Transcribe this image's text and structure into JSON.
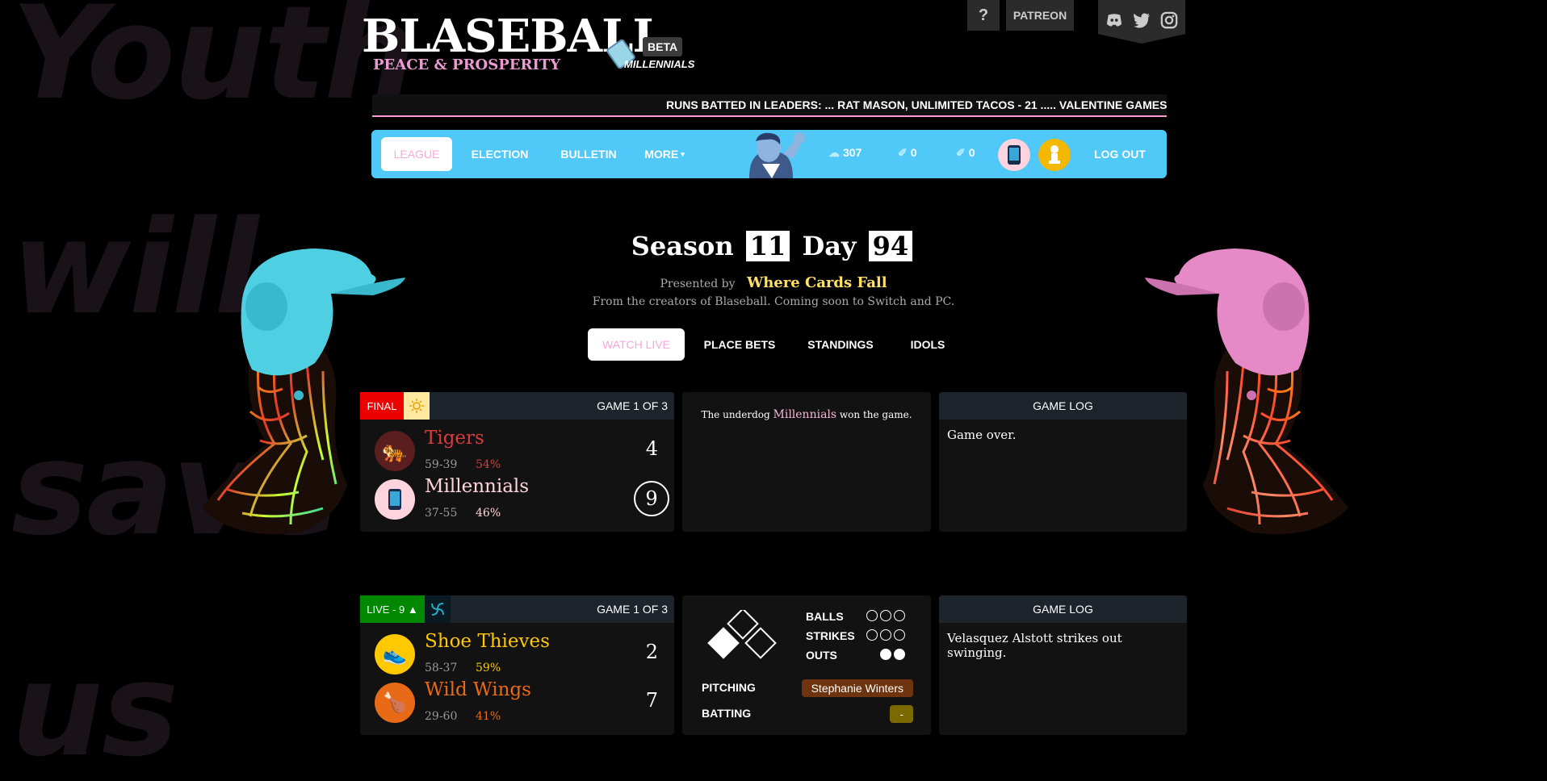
{
  "background_text": [
    "Youth",
    "will",
    "save",
    "us"
  ],
  "util": {
    "help_label": "?",
    "patreon_label": "PATREON"
  },
  "socials": [
    "discord-icon",
    "twitter-icon",
    "instagram-icon"
  ],
  "logo": {
    "title": "BLASEBALL",
    "subtitle": "PEACE & PROSPERITY",
    "badge": "BETA",
    "team_logo": "MILLENNIALS"
  },
  "ticker": {
    "text": "RUNS BATTED IN LEADERS: ... RAT MASON, UNLIMITED TACOS - 21 ..... VALENTINE GAMES, U"
  },
  "nav": {
    "league": "LEAGUE",
    "election": "ELECTION",
    "bulletin": "BULLETIN",
    "more": "MORE",
    "coins_glyph": "☁",
    "coins": "307",
    "votes_glyph": "✐",
    "votes": "0",
    "snacks_glyph": "✐",
    "snacks": "0",
    "logout": "LOG OUT"
  },
  "season": {
    "season_label": "Season",
    "season_num": "11",
    "day_label": "Day",
    "day_num": "94"
  },
  "sponsor": {
    "presented_by": "Presented by",
    "name": "Where Cards Fall",
    "tagline": "From the creators of Blaseball. Coming soon to Switch and PC."
  },
  "tabs": {
    "watch_live": "WATCH LIVE",
    "place_bets": "PLACE BETS",
    "standings": "STANDINGS",
    "idols": "IDOLS"
  },
  "game1": {
    "status": "FINAL",
    "game_number": "GAME 1 OF 3",
    "away": {
      "name": "Tigers",
      "record": "59-39",
      "odds": "54%",
      "score": "4",
      "color": "#d93c3c",
      "emoji": "🐅"
    },
    "home": {
      "name": "Millennials",
      "record": "37-55",
      "odds": "46%",
      "score": "9",
      "color": "#ffd4df",
      "emoji": "📱"
    },
    "summary_pre": "The underdog",
    "summary_team": "Millennials",
    "summary_post": "won the game.",
    "log_header": "GAME LOG",
    "log_text": "Game over."
  },
  "game2": {
    "status": "LIVE - 9 ▲",
    "game_number": "GAME 1 OF 3",
    "away": {
      "name": "Shoe Thieves",
      "record": "58-37",
      "odds": "59%",
      "score": "2",
      "color": "#ffc800",
      "emoji": "👟"
    },
    "home": {
      "name": "Wild Wings",
      "record": "29-60",
      "odds": "41%",
      "score": "7",
      "color": "#e86a17",
      "emoji": "🍗"
    },
    "balls_label": "BALLS",
    "strikes_label": "STRIKES",
    "outs_label": "OUTS",
    "balls": 0,
    "strikes": 0,
    "outs": 2,
    "pitching_label": "PITCHING",
    "pitcher": "Stephanie Winters",
    "pitcher_color": "#6e3410",
    "batting_label": "BATTING",
    "batter": "-",
    "batter_color": "#7a6a00",
    "log_header": "GAME LOG",
    "log_text": "Velasquez Alstott strikes out swinging."
  },
  "colors": {
    "nav_blue": "#50c8f8",
    "accent_pink": "#f6a8d8",
    "final_red": "#ee0000",
    "live_green": "#008800"
  }
}
